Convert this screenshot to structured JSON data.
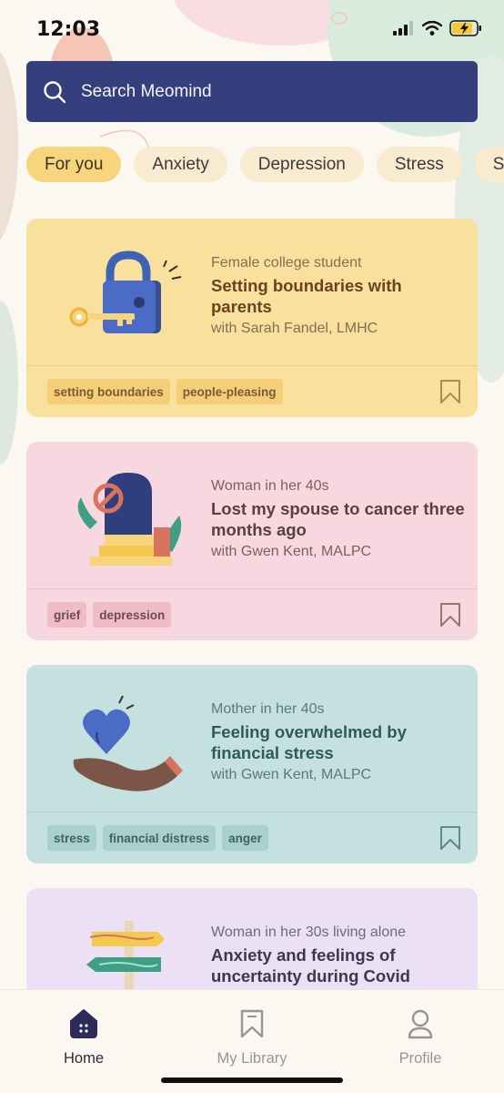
{
  "status_bar": {
    "time": "12:03"
  },
  "search": {
    "placeholder": "Search Meomind"
  },
  "chips": [
    "For you",
    "Anxiety",
    "Depression",
    "Stress",
    "S"
  ],
  "cards": [
    {
      "subtitle": "Female college student",
      "title": "Setting boundaries with parents",
      "therapist": "with Sarah Fandel, LMHC",
      "tags": [
        "setting boundaries",
        "people-pleasing"
      ]
    },
    {
      "subtitle": "Woman in her 40s",
      "title": "Lost my spouse to cancer three months ago",
      "therapist": "with Gwen Kent, MALPC",
      "tags": [
        "grief",
        "depression"
      ]
    },
    {
      "subtitle": "Mother in her 40s",
      "title": "Feeling overwhelmed by financial stress",
      "therapist": "with Gwen Kent, MALPC",
      "tags": [
        "stress",
        "financial distress",
        "anger"
      ]
    },
    {
      "subtitle": "Woman in her 30s living alone",
      "title": "Anxiety and feelings of uncertainty during Covid"
    }
  ],
  "tab_bar": {
    "home": "Home",
    "library": "My Library",
    "profile": "Profile"
  },
  "colors": {
    "search_bg": "#363f7e",
    "chip_active": "#f7d57c",
    "chip": "#f8ebd0",
    "home_active": "#2e2a5a",
    "tab_inactive": "#9a9499"
  }
}
